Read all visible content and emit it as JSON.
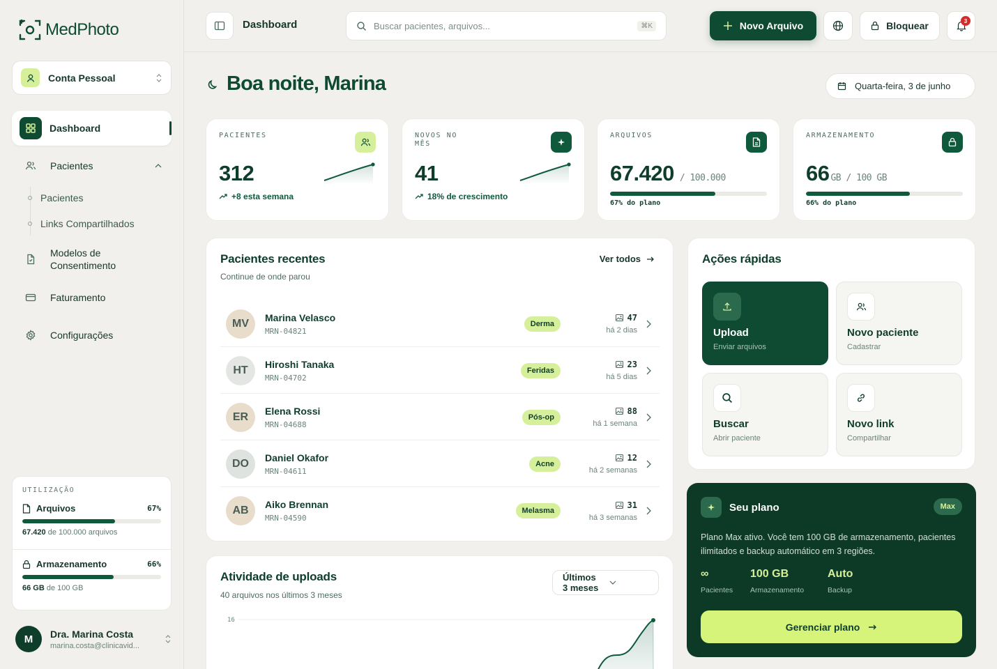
{
  "app": {
    "logo_text_a": "Med",
    "logo_text_b": "Photo"
  },
  "account": {
    "label": "Conta Pessoal"
  },
  "nav": {
    "dashboard": "Dashboard",
    "patients": "Pacientes",
    "sub_patients": "Pacientes",
    "sub_links": "Links Compartilhados",
    "consent": "Modelos de Consentimento",
    "billing": "Faturamento",
    "settings": "Configurações"
  },
  "usage": {
    "title": "UTILIZAÇÃO",
    "files_label": "Arquivos",
    "files_pct": "67%",
    "files_fill": 0.67,
    "files_used": "67.420",
    "files_rest": " de 100.000 arquivos",
    "storage_label": "Armazenamento",
    "storage_pct": "66%",
    "storage_fill": 0.66,
    "storage_used": "66 GB",
    "storage_rest": " de 100 GB"
  },
  "user": {
    "initial": "M",
    "name": "Dra. Marina Costa",
    "email": "marina.costa@clinicavid..."
  },
  "topbar": {
    "breadcrumb": "Dashboard",
    "search_placeholder": "Buscar pacientes, arquivos...",
    "search_shortcut": "⌘K",
    "new_button": "Novo Arquivo",
    "lock_button": "Bloquear",
    "notifications": "3"
  },
  "greeting": {
    "title": "Boa noite, Marina",
    "date": "Quarta-feira, 3 de junho"
  },
  "stats": {
    "patients": {
      "label": "PACIENTES",
      "value": "312",
      "foot": "+8 esta semana"
    },
    "new": {
      "label": "NOVOS NO MÊS",
      "value": "41",
      "foot": "18% de crescimento"
    },
    "files": {
      "label": "ARQUIVOS",
      "value": "67.420",
      "unit": "/ 100.000",
      "fill": 0.67,
      "foot": "67% do plano"
    },
    "storage": {
      "label": "ARMAZENAMENTO",
      "value": "66",
      "unit": "GB / 100 GB",
      "fill": 0.66,
      "foot": "66% do plano"
    }
  },
  "recent": {
    "title": "Pacientes recentes",
    "subtitle": "Continue de onde parou",
    "see_all": "Ver todos",
    "rows": [
      {
        "initials": "MV",
        "name": "Marina Velasco",
        "mrn": "MRN-04821",
        "tag": "Derma",
        "count": "47",
        "when": "há 2 dias",
        "avatar_bg": "#e8dccb"
      },
      {
        "initials": "HT",
        "name": "Hiroshi Tanaka",
        "mrn": "MRN-04702",
        "tag": "Feridas",
        "count": "23",
        "when": "há 5 dias",
        "avatar_bg": "#e3e6e2"
      },
      {
        "initials": "ER",
        "name": "Elena Rossi",
        "mrn": "MRN-04688",
        "tag": "Pós-op",
        "count": "88",
        "when": "há 1 semana",
        "avatar_bg": "#e8dccb"
      },
      {
        "initials": "DO",
        "name": "Daniel Okafor",
        "mrn": "MRN-04611",
        "tag": "Acne",
        "count": "12",
        "when": "há 2 semanas",
        "avatar_bg": "#dfe3df"
      },
      {
        "initials": "AB",
        "name": "Aiko Brennan",
        "mrn": "MRN-04590",
        "tag": "Melasma",
        "count": "31",
        "when": "há 3 semanas",
        "avatar_bg": "#e8dccb"
      }
    ]
  },
  "activity": {
    "title": "Atividade de uploads",
    "subtitle": "40 arquivos nos últimos 3 meses",
    "range": "Últimos 3 meses",
    "y_tick": "16"
  },
  "quick": {
    "title": "Ações rápidas",
    "actions": [
      {
        "title": "Upload",
        "sub": "Enviar arquivos"
      },
      {
        "title": "Novo paciente",
        "sub": "Cadastrar"
      },
      {
        "title": "Buscar",
        "sub": "Abrir paciente"
      },
      {
        "title": "Novo link",
        "sub": "Compartilhar"
      }
    ]
  },
  "plan": {
    "title": "Seu plano",
    "badge": "Max",
    "description": "Plano Max ativo. Você tem 100 GB de armazenamento, pacientes ilimitados e backup automático em 3 regiões.",
    "stats": [
      {
        "value": "∞",
        "label": "Pacientes"
      },
      {
        "value": "100 GB",
        "label": "Armazenamento"
      },
      {
        "value": "Auto",
        "label": "Backup"
      }
    ],
    "button": "Gerenciar plano"
  },
  "colors": {
    "brand": "#0f4a33",
    "accent": "#d6ef9a",
    "cta": "#d6f37a",
    "alert": "#d62b2b"
  }
}
